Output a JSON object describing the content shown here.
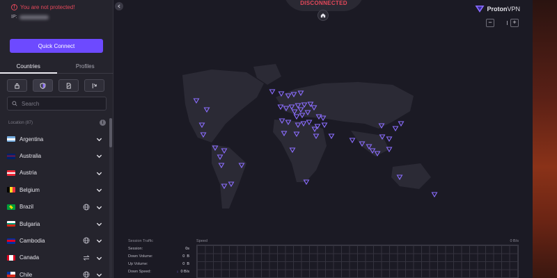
{
  "status": {
    "warning": "You are not protected!",
    "ip_label": "IP:",
    "connection_state": "DISCONNECTED"
  },
  "sidebar": {
    "quick_connect_label": "Quick Connect",
    "tabs": [
      "Countries",
      "Profiles"
    ],
    "active_tab": "Countries",
    "filters": [
      "lock-icon",
      "shield-icon",
      "document-icon",
      "arrows-icon"
    ],
    "search": {
      "placeholder": "Search",
      "value": ""
    },
    "location_header": "Location (87)",
    "countries": [
      {
        "name": "Argentina",
        "extra": ""
      },
      {
        "name": "Australia",
        "extra": ""
      },
      {
        "name": "Austria",
        "extra": ""
      },
      {
        "name": "Belgium",
        "extra": ""
      },
      {
        "name": "Brazil",
        "extra": "globe-icon"
      },
      {
        "name": "Bulgaria",
        "extra": ""
      },
      {
        "name": "Cambodia",
        "extra": "globe-icon"
      },
      {
        "name": "Canada",
        "extra": "p2p-arrows-icon"
      },
      {
        "name": "Chile",
        "extra": "globe-icon"
      }
    ]
  },
  "brand": {
    "name_bold": "Proton",
    "name_rest": "VPN"
  },
  "zoom": {
    "minus": "−",
    "plus": "+"
  },
  "traffic": {
    "title": "Session Traffic",
    "rows": [
      {
        "label": "Session:",
        "value": "0s"
      },
      {
        "label": "Down Volume:",
        "value": "0",
        "unit": "B"
      },
      {
        "label": "Up Volume:",
        "value": "0",
        "unit": "B"
      },
      {
        "label": "Down Speed:",
        "value": "0",
        "unit": "B/s"
      }
    ],
    "speed_label": "Speed",
    "speed_max": "0 B/s"
  },
  "colors": {
    "accent": "#6d4aff",
    "danger": "#e5485a",
    "server_marker": "#8b6dff"
  }
}
